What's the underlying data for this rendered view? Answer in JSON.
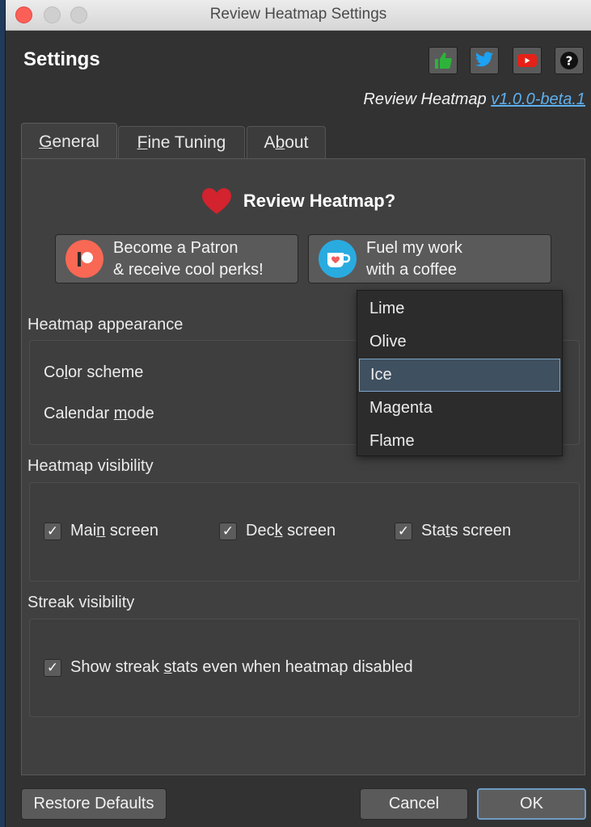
{
  "window": {
    "title": "Review Heatmap Settings"
  },
  "header": {
    "title": "Settings",
    "buttons": [
      {
        "name": "thumbs-up",
        "icon": "thumbs-up-icon",
        "color": "#2db33b"
      },
      {
        "name": "twitter",
        "icon": "twitter-icon",
        "color": "#1da1f2"
      },
      {
        "name": "youtube",
        "icon": "youtube-icon",
        "color": "#e62117"
      },
      {
        "name": "help",
        "icon": "help-icon",
        "color": "#111111"
      }
    ],
    "app_name": "Review Heatmap",
    "version": "v1.0.0-beta.1"
  },
  "tabs": [
    {
      "label": "General",
      "accel_index": 0,
      "active": true
    },
    {
      "label": "Fine Tuning",
      "accel_index": 0,
      "active": false
    },
    {
      "label": "About",
      "accel_index": 1,
      "active": false
    }
  ],
  "promo": {
    "title": "Review Heatmap?",
    "patron_line1": "Become a Patron",
    "patron_line2": "& receive cool perks!",
    "coffee_line1": "Fuel my work",
    "coffee_line2": "with a coffee"
  },
  "appearance": {
    "group_label": "Heatmap appearance",
    "color_scheme_label": "Color scheme",
    "calendar_mode_label": "Calendar mode",
    "color_options": [
      "Lime",
      "Olive",
      "Ice",
      "Magenta",
      "Flame"
    ],
    "selected_option": "Ice"
  },
  "visibility": {
    "group_label": "Heatmap visibility",
    "main_screen": {
      "label": "Main screen",
      "checked": true
    },
    "deck_screen": {
      "label": "Deck screen",
      "checked": true
    },
    "stats_screen": {
      "label": "Stats screen",
      "checked": true
    }
  },
  "streak": {
    "group_label": "Streak visibility",
    "show_streak": {
      "label": "Show streak stats even when heatmap disabled",
      "checked": true
    }
  },
  "footer": {
    "restore_label": "Restore Defaults",
    "cancel_label": "Cancel",
    "ok_label": "OK"
  },
  "colors": {
    "accent_link": "#5fb0ee",
    "heart": "#d2232f",
    "patreon": "#f96854",
    "kofi": "#29abe0",
    "selection_border": "#7fa5c8"
  }
}
